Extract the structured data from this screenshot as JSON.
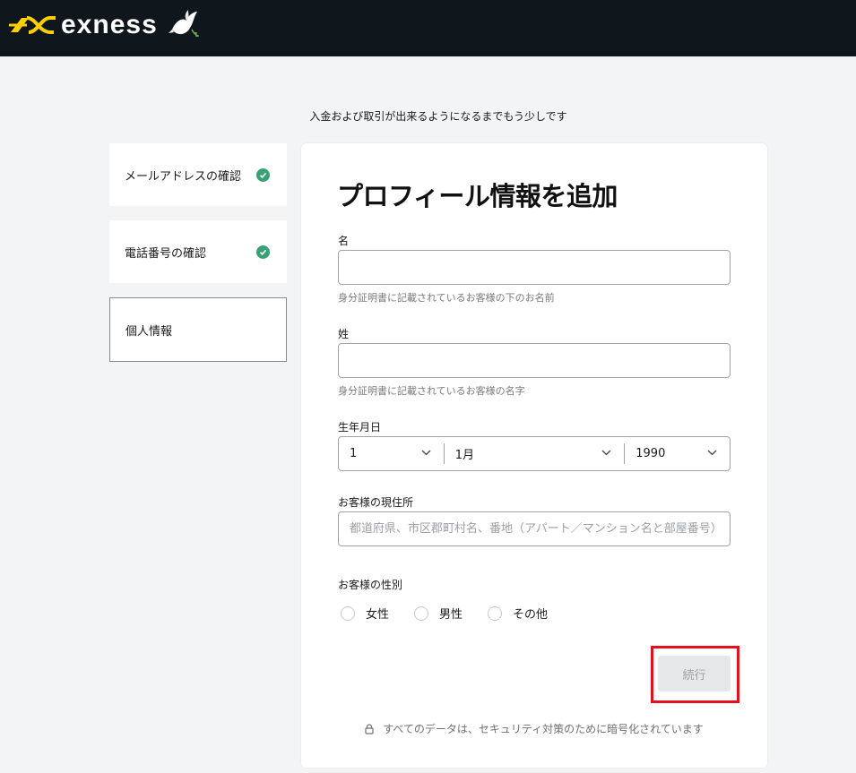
{
  "header": {
    "brand": "exness"
  },
  "page": {
    "tagline": "入金および取引が出来るようになるまでもう少しです"
  },
  "steps": [
    {
      "label": "メールアドレスの確認",
      "done": true
    },
    {
      "label": "電話番号の確認",
      "done": true
    },
    {
      "label": "個人情報",
      "done": false,
      "active": true
    }
  ],
  "form": {
    "title": "プロフィール情報を追加",
    "first_name": {
      "label": "名",
      "value": "",
      "hint": "身分証明書に記載されているお客様の下のお名前"
    },
    "last_name": {
      "label": "姓",
      "value": "",
      "hint": "身分証明書に記載されているお客様の名字"
    },
    "dob": {
      "label": "生年月日",
      "day": "1",
      "month": "1月",
      "year": "1990"
    },
    "address": {
      "label": "お客様の現住所",
      "value": "",
      "placeholder": "都道府県、市区郡町村名、番地（アパート／マンション名と部屋番号）"
    },
    "gender": {
      "label": "お客様の性別",
      "options": [
        "女性",
        "男性",
        "その他"
      ],
      "selected": ""
    },
    "submit_label": "続行",
    "secure_note": "すべてのデータは、セキュリティ対策のために暗号化されています"
  },
  "colors": {
    "topbar": "#0f161c",
    "brand_yellow": "#ffcf01",
    "check_green": "#3aa176",
    "highlight_red": "#e3101e"
  }
}
